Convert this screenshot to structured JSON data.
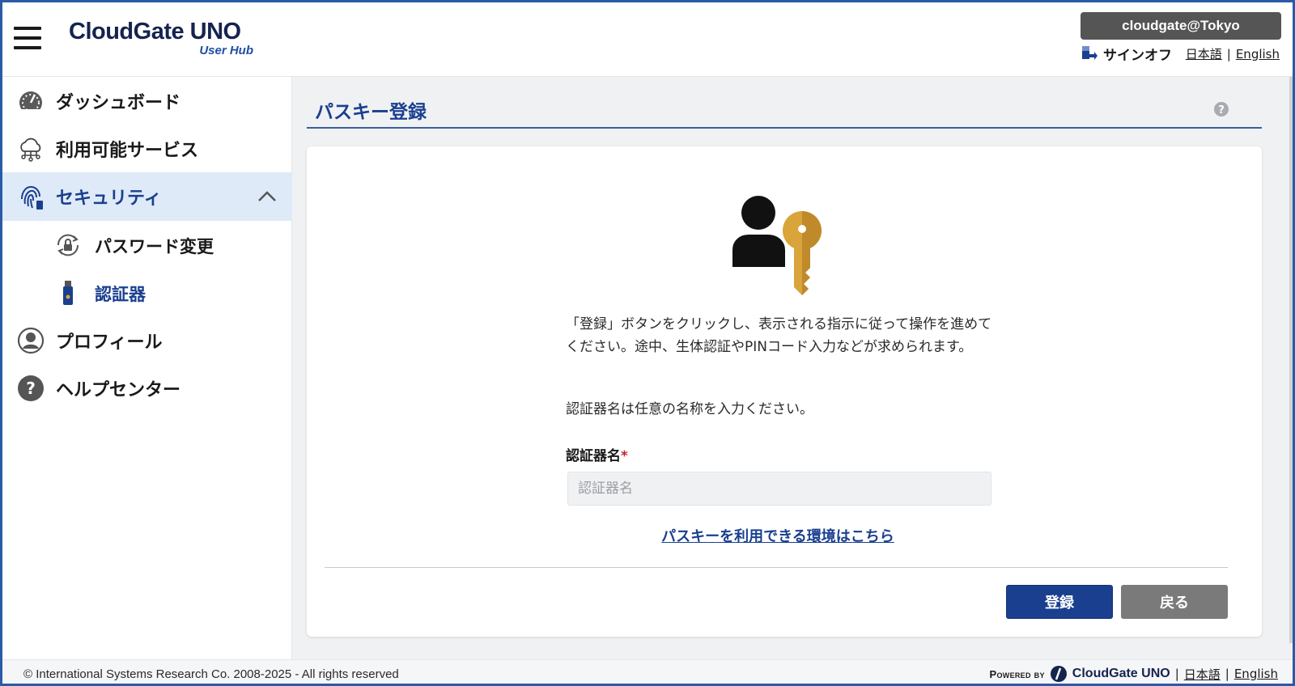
{
  "header": {
    "logo_main": "CloudGate UNO",
    "logo_sub": "User Hub",
    "user": "cloudgate@Tokyo",
    "signoff": "サインオフ",
    "lang_ja": "日本語",
    "lang_sep": "|",
    "lang_en": "English"
  },
  "sidebar": {
    "items": [
      {
        "label": "ダッシュボード",
        "icon": "gauge-icon"
      },
      {
        "label": "利用可能サービス",
        "icon": "cloud-network-icon"
      },
      {
        "label": "セキュリティ",
        "icon": "fingerprint-icon",
        "active": true,
        "expanded": true
      },
      {
        "label": "パスワード変更",
        "icon": "lock-refresh-icon"
      },
      {
        "label": "認証器",
        "icon": "security-key-icon",
        "current": true
      },
      {
        "label": "プロフィール",
        "icon": "user-circle-icon"
      },
      {
        "label": "ヘルプセンター",
        "icon": "help-circle-icon"
      }
    ]
  },
  "main": {
    "title": "パスキー登録",
    "description": "「登録」ボタンをクリックし、表示される指示に従って操作を進めてください。途中、生体認証やPINコード入力などが求められます。",
    "description2": "認証器名は任意の名称を入力ください。",
    "field_label": "認証器名",
    "required_mark": "*",
    "field_value": "",
    "field_placeholder": "認証器名",
    "env_link": "パスキーを利用できる環境はこちら",
    "register_button": "登録",
    "back_button": "戻る"
  },
  "footer": {
    "copyright": "© International Systems Research Co.   2008-2025 - All rights reserved",
    "powered_by": "Powered by",
    "logo_text": "CloudGate UNO",
    "lang_ja": "日本語",
    "lang_sep": "|",
    "lang_en": "English"
  },
  "colors": {
    "brand": "#1a3f8f",
    "active_bg": "#deeaf7",
    "key_gold": "#d9a43a",
    "back_button": "#7a7a7a"
  }
}
